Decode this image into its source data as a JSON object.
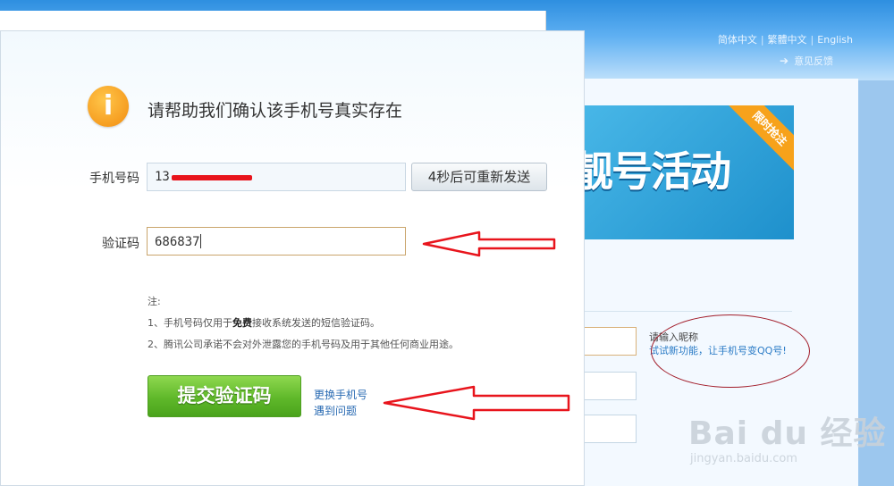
{
  "background_page": {
    "languages": [
      "简体中文",
      "繁體中文",
      "English"
    ],
    "feedback": "意见反馈",
    "banner_text": "靓号活动",
    "banner_ribbon": "限时抢注",
    "nickname_hint": "请输入昵称",
    "nickname_tip": "试试新功能，让手机号变QQ号!",
    "watermark": "Bai du 经验",
    "watermark_url": "jingyan.baidu.com"
  },
  "dialog": {
    "icon": "info-icon",
    "heading": "请帮助我们确认该手机号真实存在",
    "phone_label": "手机号码",
    "phone_value": "13",
    "resend_button": "4秒后可重新发送",
    "code_label": "验证码",
    "code_value": "686837",
    "notes_title": "注:",
    "note_1_a": "1、手机号码仅用于",
    "note_1_b": "免费",
    "note_1_c": "接收系统发送的短信验证码。",
    "note_2": "2、腾讯公司承诺不会对外泄露您的手机号码及用于其他任何商业用途。",
    "submit_button": "提交验证码",
    "change_phone_link": "更换手机号",
    "problem_link": "遇到问题"
  },
  "colors": {
    "annotation_arrow": "#e8141c",
    "annotation_circle": "#a21d2a",
    "submit_green": "#5fb82a",
    "link_blue": "#2a6bb3"
  }
}
